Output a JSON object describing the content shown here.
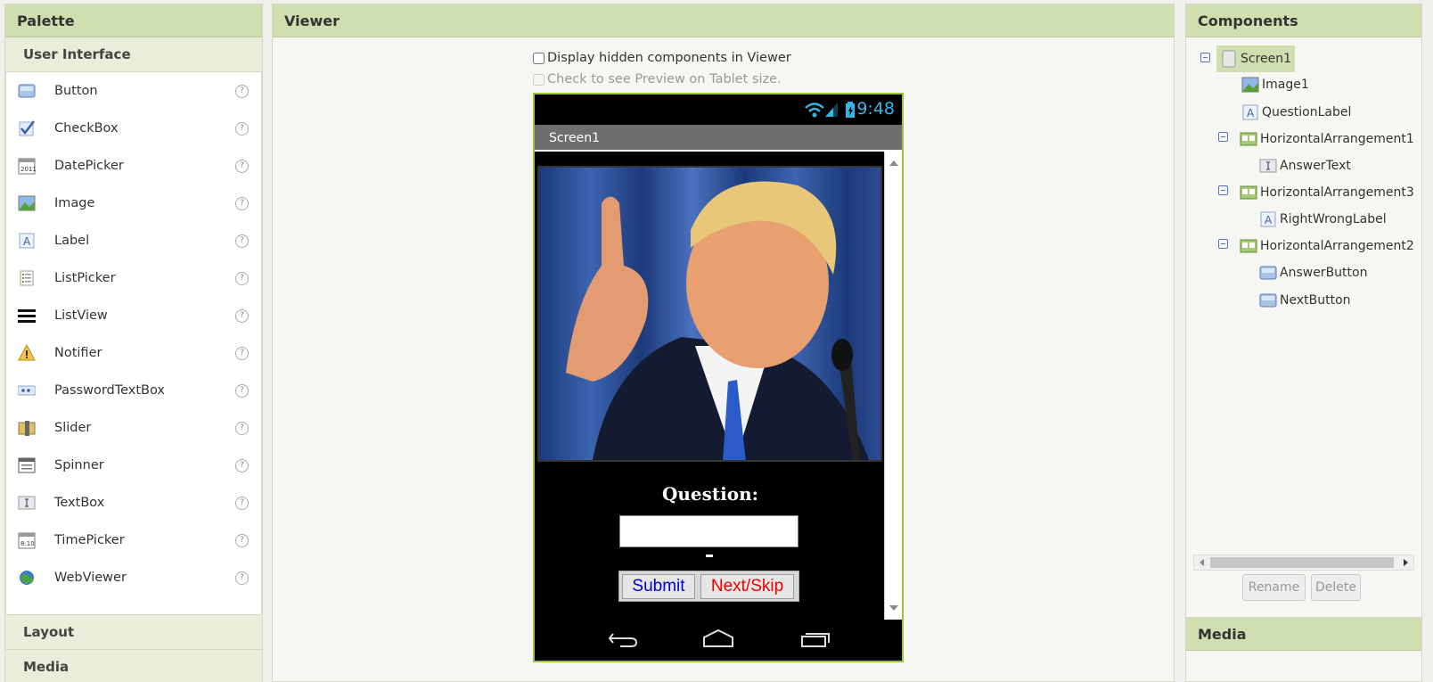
{
  "palette": {
    "title": "Palette",
    "category_open": "User Interface",
    "items": [
      {
        "label": "Button",
        "icon": "button-icon"
      },
      {
        "label": "CheckBox",
        "icon": "checkbox-icon"
      },
      {
        "label": "DatePicker",
        "icon": "datepicker-icon"
      },
      {
        "label": "Image",
        "icon": "image-icon"
      },
      {
        "label": "Label",
        "icon": "label-icon"
      },
      {
        "label": "ListPicker",
        "icon": "listpicker-icon"
      },
      {
        "label": "ListView",
        "icon": "listview-icon"
      },
      {
        "label": "Notifier",
        "icon": "notifier-icon"
      },
      {
        "label": "PasswordTextBox",
        "icon": "passwordtextbox-icon"
      },
      {
        "label": "Slider",
        "icon": "slider-icon"
      },
      {
        "label": "Spinner",
        "icon": "spinner-icon"
      },
      {
        "label": "TextBox",
        "icon": "textbox-icon"
      },
      {
        "label": "TimePicker",
        "icon": "timepicker-icon"
      },
      {
        "label": "WebViewer",
        "icon": "webviewer-icon"
      }
    ],
    "help_glyph": "?",
    "category_layout": "Layout",
    "category_media": "Media"
  },
  "viewer": {
    "title": "Viewer",
    "option_hidden": "Display hidden components in Viewer",
    "option_tablet": "Check to see Preview on Tablet size.",
    "phone": {
      "clock": "9:48",
      "screen_title": "Screen1",
      "question_label": "Question:",
      "right_wrong_label": "-",
      "submit_label": "Submit",
      "next_label": "Next/Skip",
      "submit_color": "#0000cc",
      "next_color": "#ee0000"
    }
  },
  "components": {
    "title": "Components",
    "tree": [
      {
        "label": "Screen1",
        "icon": "screen-icon"
      },
      {
        "label": "Image1",
        "icon": "image-icon"
      },
      {
        "label": "QuestionLabel",
        "icon": "label-icon"
      },
      {
        "label": "HorizontalArrangement1",
        "icon": "horizontal-arrangement-icon"
      },
      {
        "label": "AnswerText",
        "icon": "textbox-icon"
      },
      {
        "label": "HorizontalArrangement3",
        "icon": "horizontal-arrangement-icon"
      },
      {
        "label": "RightWrongLabel",
        "icon": "label-icon"
      },
      {
        "label": "HorizontalArrangement2",
        "icon": "horizontal-arrangement-icon"
      },
      {
        "label": "AnswerButton",
        "icon": "button-icon"
      },
      {
        "label": "NextButton",
        "icon": "button-icon"
      }
    ],
    "rename_label": "Rename",
    "delete_label": "Delete"
  },
  "media": {
    "title": "Media"
  },
  "colors": {
    "header_bg": "#cfdfaf",
    "accent_border": "#9ac13f",
    "clock_blue": "#33b5e5"
  }
}
